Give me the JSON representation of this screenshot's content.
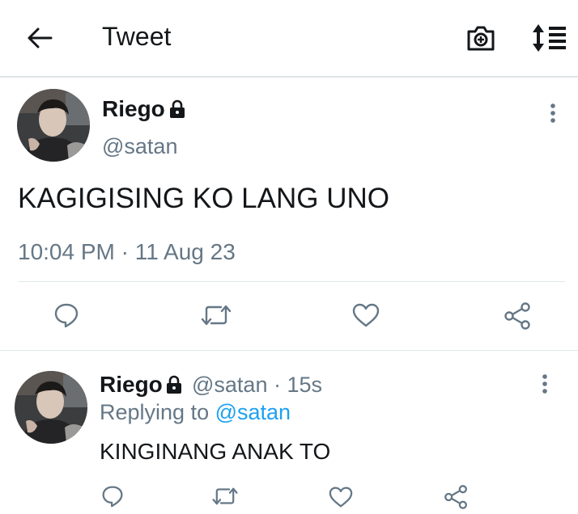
{
  "appbar": {
    "title": "Tweet",
    "icons": [
      "back-arrow-icon",
      "camera-icon",
      "sort-icon"
    ]
  },
  "main_tweet": {
    "name": "Riego",
    "handle": "@satan",
    "text": "KAGIGISING KO LANG UNO",
    "time": "10:04 PM",
    "separator": "·",
    "date": "11 Aug 23",
    "actions": [
      "reply-icon",
      "retweet-icon",
      "like-icon",
      "share-icon"
    ]
  },
  "reply_tweet": {
    "name": "Riego",
    "handle": "@satan",
    "separator": "·",
    "age": "15s",
    "replying_prefix": "Replying to",
    "replying_handle": "@satan",
    "text": "KINGINANG ANAK TO",
    "actions": [
      "reply-icon",
      "retweet-icon",
      "like-icon",
      "share-icon"
    ]
  },
  "colors": {
    "text": "#14171a",
    "secondary": "#657786",
    "link": "#1da1f2",
    "divider": "#e1e6ea"
  }
}
